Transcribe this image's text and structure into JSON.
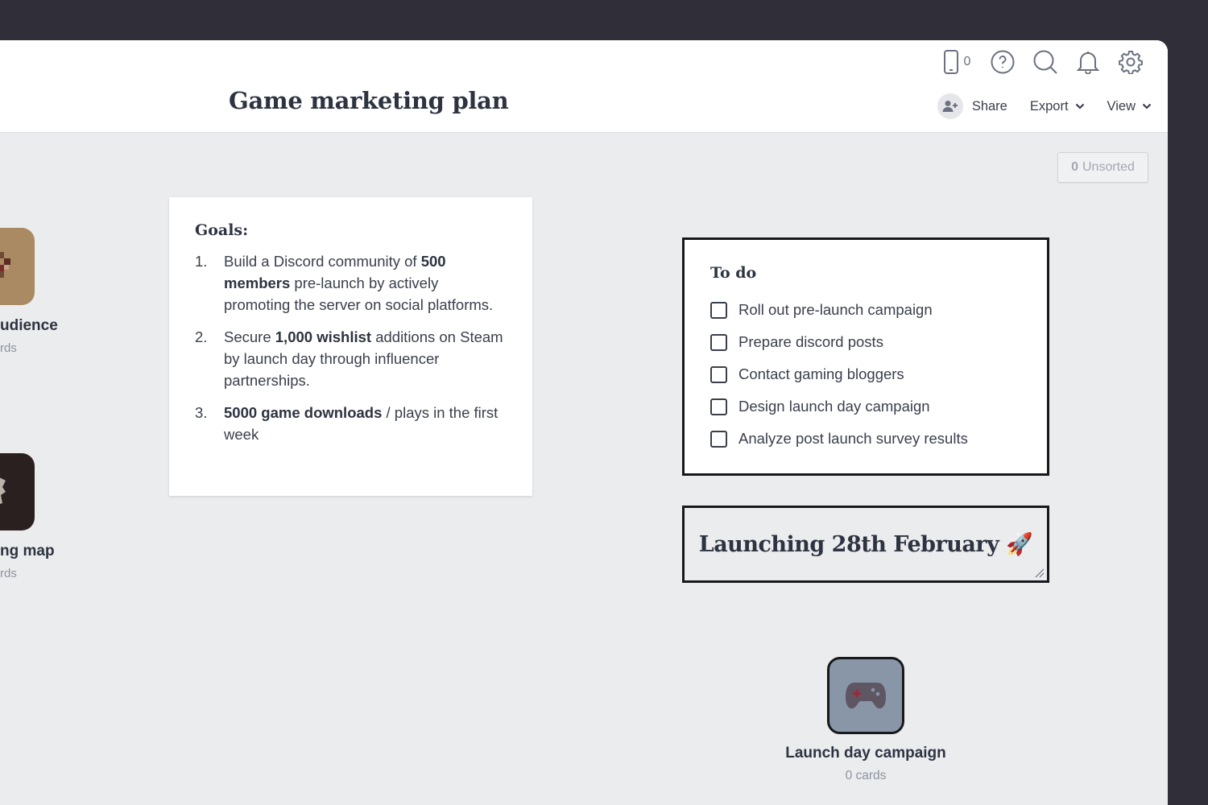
{
  "header": {
    "title": "Game marketing plan",
    "device_count": "0",
    "share_label": "Share",
    "export_label": "Export",
    "view_label": "View",
    "icons": [
      "phone-icon",
      "help-icon",
      "search-icon",
      "bell-icon",
      "gear-icon",
      "add-user-icon",
      "chevron-down-icon"
    ]
  },
  "unsorted": {
    "count": "0",
    "label": "Unsorted"
  },
  "side_boards": [
    {
      "title": "udience",
      "sub": "rds"
    },
    {
      "title": "ng map",
      "sub": "rds"
    }
  ],
  "goals": {
    "heading": "Goals:",
    "items": [
      {
        "num": "1.",
        "parts": [
          {
            "t": "Build a Discord community of "
          },
          {
            "b": "500 members"
          },
          {
            "t": " pre-launch by actively promoting the server on social platforms."
          }
        ]
      },
      {
        "num": "2.",
        "parts": [
          {
            "t": "Secure "
          },
          {
            "b": "1,000 wishlist"
          },
          {
            "t": " additions on Steam by launch day through influencer partnerships."
          }
        ]
      },
      {
        "num": "3.",
        "parts": [
          {
            "b": "5000 game downloads"
          },
          {
            "t": " / plays in the first week"
          }
        ]
      }
    ]
  },
  "todo": {
    "heading": "To do",
    "items": [
      {
        "label": "Roll out pre-launch campaign",
        "checked": false
      },
      {
        "label": "Prepare discord posts",
        "checked": false
      },
      {
        "label": "Contact gaming bloggers",
        "checked": false
      },
      {
        "label": "Design launch day campaign",
        "checked": false
      },
      {
        "label": "Analyze post launch survey results",
        "checked": false
      }
    ]
  },
  "launch_note": {
    "text": "Launching 28th February 🚀"
  },
  "board": {
    "title": "Launch day campaign",
    "sub": "0 cards",
    "icon": "gamepad-icon"
  },
  "colors": {
    "background": "#2f2e39",
    "canvas": "#ebecee",
    "board_tile": "#8896a8",
    "border": "#17181c"
  }
}
